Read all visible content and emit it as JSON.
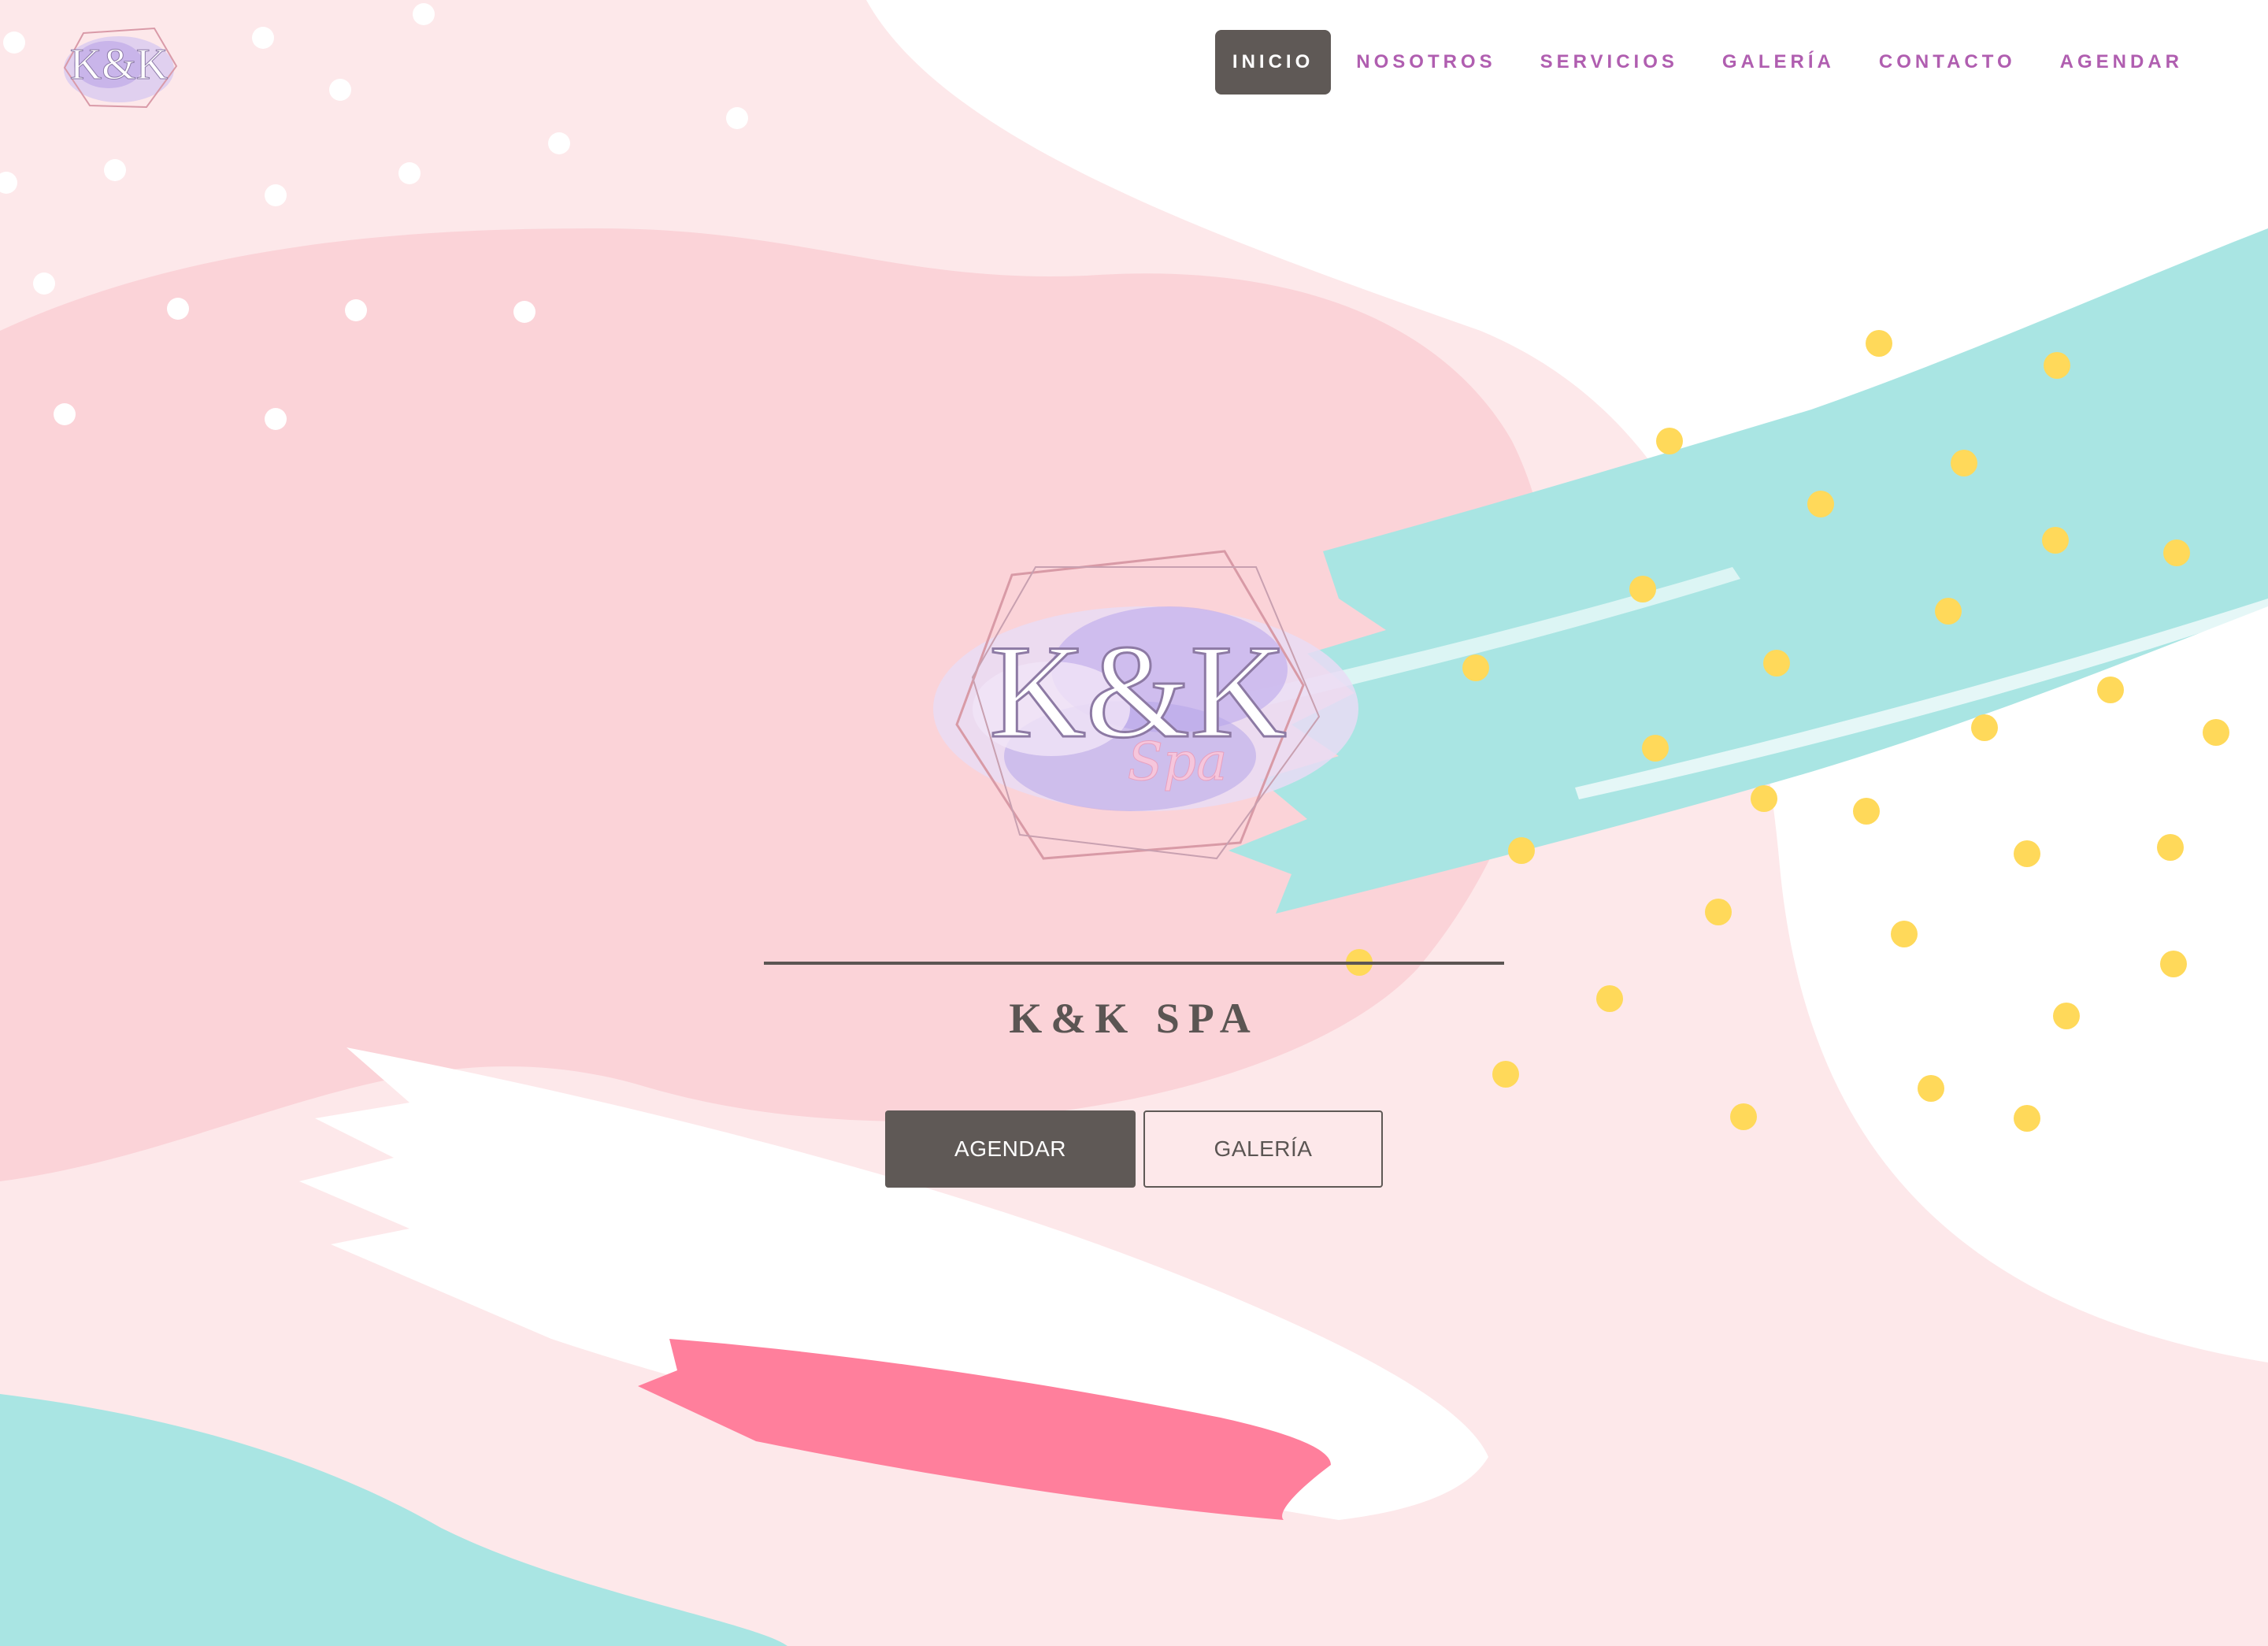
{
  "brand": {
    "logo_text": "K&K",
    "logo_script": "Spa"
  },
  "nav": {
    "items": [
      {
        "label": "INICIO",
        "active": true
      },
      {
        "label": "NOSOTROS",
        "active": false
      },
      {
        "label": "SERVICIOS",
        "active": false
      },
      {
        "label": "GALERÍA",
        "active": false
      },
      {
        "label": "CONTACTO",
        "active": false
      },
      {
        "label": "AGENDAR",
        "active": false
      }
    ]
  },
  "hero": {
    "title": "K&K SPA",
    "primary_button": "AGENDAR",
    "secondary_button": "GALERÍA"
  },
  "colors": {
    "nav_text": "#b05eb0",
    "button_dark": "#5f5956",
    "pink_light": "#fde8ea",
    "pink": "#fbd3d8",
    "mint": "#a9e5e3",
    "hot_pink": "#ff7f9c",
    "yellow_dots": "#ffd95a"
  }
}
